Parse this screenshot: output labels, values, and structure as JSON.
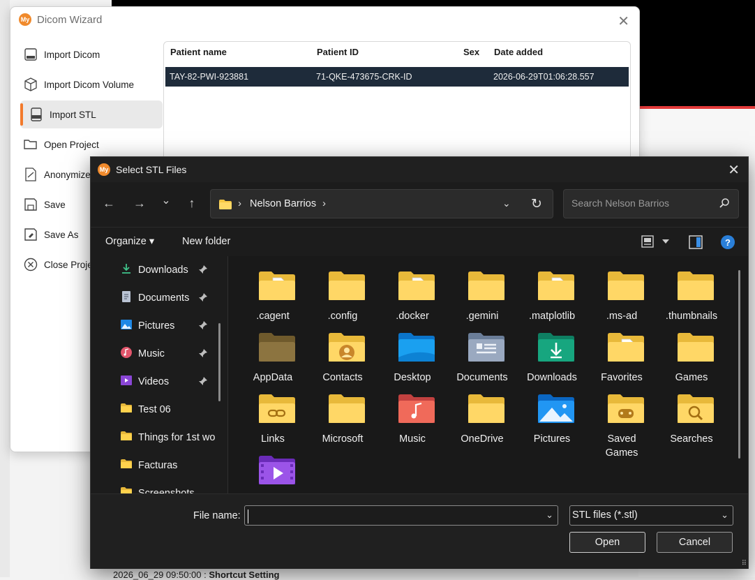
{
  "background": {
    "bottom_text_time": "2026_06_29 09:50:00 :",
    "bottom_text_bold": "Shortcut Setting"
  },
  "wizard": {
    "logo": "My",
    "title": "Dicom Wizard",
    "close_glyph": "✕",
    "menu": [
      {
        "label": "Import Dicom",
        "icon": "dicom-file-icon"
      },
      {
        "label": "Import Dicom Volume",
        "icon": "cube-icon"
      },
      {
        "label": "Import STL",
        "icon": "stl-file-icon"
      },
      {
        "label": "Open Project",
        "icon": "folder-open-icon"
      },
      {
        "label": "Anonymize",
        "icon": "anonymize-icon"
      },
      {
        "label": "Save",
        "icon": "save-icon"
      },
      {
        "label": "Save As",
        "icon": "save-as-icon"
      },
      {
        "label": "Close Project",
        "icon": "close-circle-icon"
      }
    ],
    "table": {
      "headers": [
        "Patient name",
        "Patient ID",
        "Sex",
        "Date added"
      ],
      "rows": [
        {
          "name": "TAY-82-PWI-923881",
          "id": "71-QKE-473675-CRK-ID",
          "sex": "",
          "date": "2026-06-29T01:06:28.557"
        }
      ]
    }
  },
  "dialog": {
    "logo": "My",
    "title": "Select STL Files",
    "close_glyph": "✕",
    "nav": {
      "back": "←",
      "forward": "→",
      "recent": "⌄",
      "up": "↑"
    },
    "address": {
      "crumb": "Nelson Barrios",
      "sep": "›",
      "dropdown": "⌄",
      "refresh": "↻"
    },
    "search_placeholder": "Search Nelson Barrios",
    "toolbar": {
      "organize": "Organize ▾",
      "new_folder": "New folder",
      "help": "?"
    },
    "nav_pane": [
      {
        "label": "Downloads",
        "icon": "downloads-icon",
        "pinned": true
      },
      {
        "label": "Documents",
        "icon": "documents-icon",
        "pinned": true
      },
      {
        "label": "Pictures",
        "icon": "pictures-icon",
        "pinned": true
      },
      {
        "label": "Music",
        "icon": "music-icon",
        "pinned": true
      },
      {
        "label": "Videos",
        "icon": "videos-icon",
        "pinned": true
      },
      {
        "label": "Test 06",
        "icon": "folder-icon",
        "pinned": false
      },
      {
        "label": "Things for 1st wo",
        "icon": "folder-icon",
        "pinned": false
      },
      {
        "label": "Facturas",
        "icon": "folder-icon",
        "pinned": false
      },
      {
        "label": "Screenshots",
        "icon": "folder-icon",
        "pinned": false
      }
    ],
    "files": [
      {
        "label": ".cagent",
        "kind": "doc"
      },
      {
        "label": ".config",
        "kind": "plain"
      },
      {
        "label": ".docker",
        "kind": "doc"
      },
      {
        "label": ".gemini",
        "kind": "plain"
      },
      {
        "label": ".matplotlib",
        "kind": "doc"
      },
      {
        "label": ".ms-ad",
        "kind": "plain"
      },
      {
        "label": ".thumbnails",
        "kind": "plain"
      },
      {
        "label": "AppData",
        "kind": "dark"
      },
      {
        "label": "Contacts",
        "kind": "contacts"
      },
      {
        "label": "Desktop",
        "kind": "desktop"
      },
      {
        "label": "Documents",
        "kind": "documents"
      },
      {
        "label": "Downloads",
        "kind": "downloads"
      },
      {
        "label": "Favorites",
        "kind": "doc"
      },
      {
        "label": "Games",
        "kind": "plain"
      },
      {
        "label": "Links",
        "kind": "links"
      },
      {
        "label": "Microsoft",
        "kind": "plain"
      },
      {
        "label": "Music",
        "kind": "music"
      },
      {
        "label": "OneDrive",
        "kind": "plain"
      },
      {
        "label": "Pictures",
        "kind": "pictures"
      },
      {
        "label": "Saved Games",
        "kind": "savedgames"
      },
      {
        "label": "Searches",
        "kind": "searches"
      },
      {
        "label": "",
        "kind": "videos"
      }
    ],
    "file_name_label": "File name:",
    "file_name_value": "",
    "filter_value": "STL files (*.stl)",
    "open_label": "Open",
    "cancel_label": "Cancel"
  },
  "colors": {
    "accent_orange": "#f27a2c",
    "folder_yellow": "#f6cf5a",
    "selected_row": "#1e2b3a",
    "dialog_bg": "#1c1c1c"
  }
}
